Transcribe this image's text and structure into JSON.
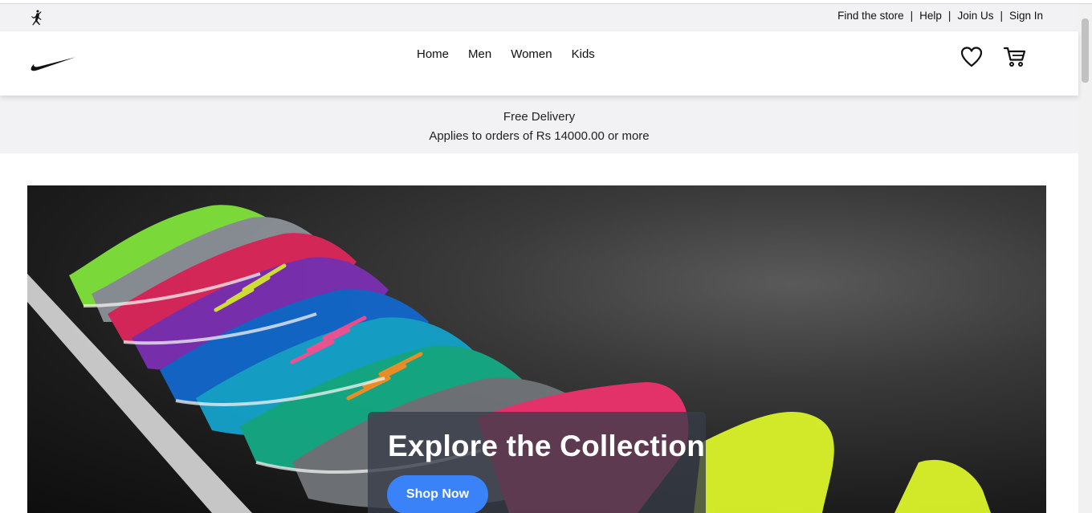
{
  "utility": {
    "links": [
      "Find the store",
      "Help",
      "Join Us",
      "Sign In"
    ],
    "separator": "|"
  },
  "nav": {
    "items": [
      "Home",
      "Men",
      "Women",
      "Kids"
    ],
    "icons": [
      "nike-swoosh-logo",
      "jordan-jumpman-logo",
      "heart-icon",
      "cart-icon"
    ]
  },
  "promo": {
    "title": "Free Delivery",
    "subtitle": "Applies to orders of Rs 14000.00 or more"
  },
  "hero": {
    "title": "Explore the Collection",
    "cta": "Shop Now"
  },
  "colors": {
    "accent": "#3a82f7",
    "bar_bg": "#f2f2f4"
  }
}
